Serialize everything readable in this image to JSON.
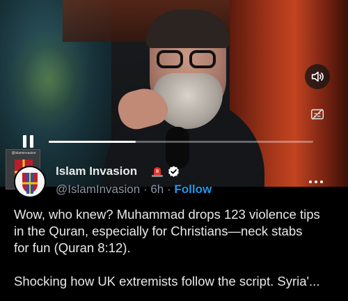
{
  "video": {
    "progress_fraction": 0.33,
    "watermark_text": "@islaminvasion",
    "icons": {
      "volume": "speaker-volume-icon",
      "subtitles": "subtitles-off-icon",
      "pause": "pause-icon"
    }
  },
  "post": {
    "author": {
      "display_name": "Islam Invasion",
      "handle": "@IslamInvasion",
      "separator": "·",
      "time": "6h",
      "follow_label": "Follow"
    },
    "text_lines": [
      "Wow, who knew? Muhammad drops 123 violence tips",
      "in the Quran, especially for Christians—neck stabs",
      "for fun (Quran 8:12).",
      "Shocking how UK extremists follow the script. Syria'..."
    ]
  },
  "colors": {
    "link_blue": "#1d9bf0",
    "text": "#e7e9ea",
    "muted": "#8b98a5",
    "background": "#000000"
  }
}
